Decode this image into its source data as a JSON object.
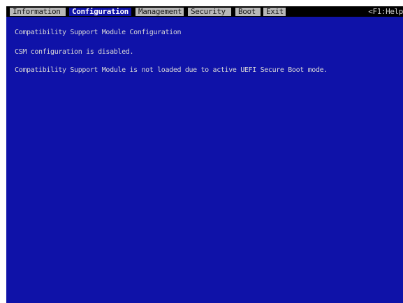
{
  "menu": {
    "tabs": [
      {
        "label": "Information"
      },
      {
        "label": "Configuration"
      },
      {
        "label": "Management"
      },
      {
        "label": "Security"
      },
      {
        "label": "Boot"
      },
      {
        "label": "Exit"
      }
    ],
    "active_tab": "Configuration",
    "help_hint": "<F1:Help"
  },
  "main": {
    "title": "Compatibility Support Module Configuration",
    "status": "CSM configuration is disabled.",
    "message": "Compatibility Support Module is not loaded due to active UEFI Secure Boot mode."
  },
  "colors": {
    "background": "#0f12a8",
    "menubar": "#000000",
    "tab_inactive": "#b8b8b8",
    "text": "#d8d8d8"
  }
}
